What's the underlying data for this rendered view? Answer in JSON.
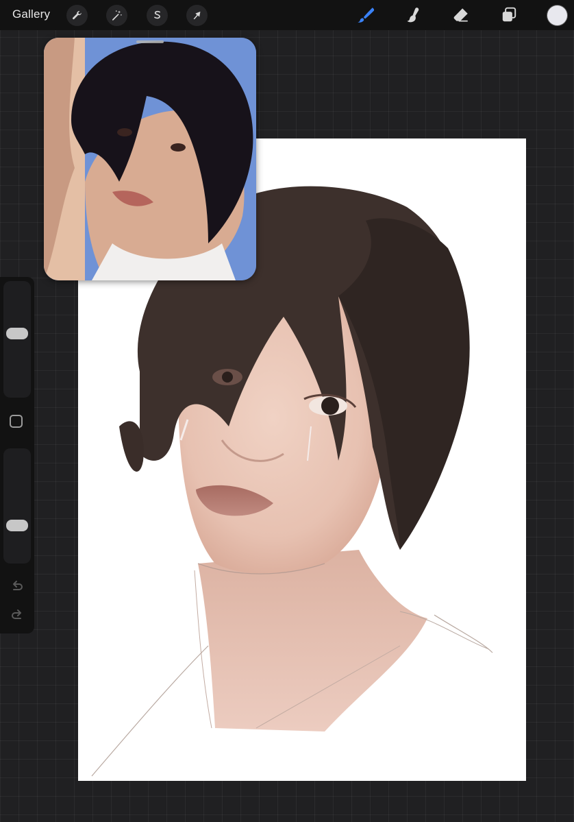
{
  "topbar": {
    "gallery_label": "Gallery",
    "left_tools": [
      {
        "name": "actions",
        "icon": "wrench-icon"
      },
      {
        "name": "adjustments",
        "icon": "magic-wand-icon"
      },
      {
        "name": "selection",
        "icon": "selection-s-icon"
      },
      {
        "name": "transform",
        "icon": "arrow-cursor-icon"
      }
    ],
    "right_tools": [
      {
        "name": "brush",
        "icon": "brush-icon",
        "active": true
      },
      {
        "name": "smudge",
        "icon": "smudge-finger-icon",
        "active": false
      },
      {
        "name": "eraser",
        "icon": "eraser-icon",
        "active": false
      },
      {
        "name": "layers",
        "icon": "layers-icon",
        "active": false
      }
    ],
    "current_color": "#e8e8ee",
    "active_color": "#3a82f7"
  },
  "sidebar": {
    "brush_size": 0.56,
    "brush_opacity": 0.3,
    "modify_icon": "square-icon",
    "undo_icon": "undo-arrow-icon",
    "redo_icon": "redo-arrow-icon"
  },
  "reference_window": {
    "icon": "photo-reference",
    "background": "#6f92d6"
  },
  "canvas": {
    "background": "#ffffff",
    "subject": "painted-portrait"
  }
}
